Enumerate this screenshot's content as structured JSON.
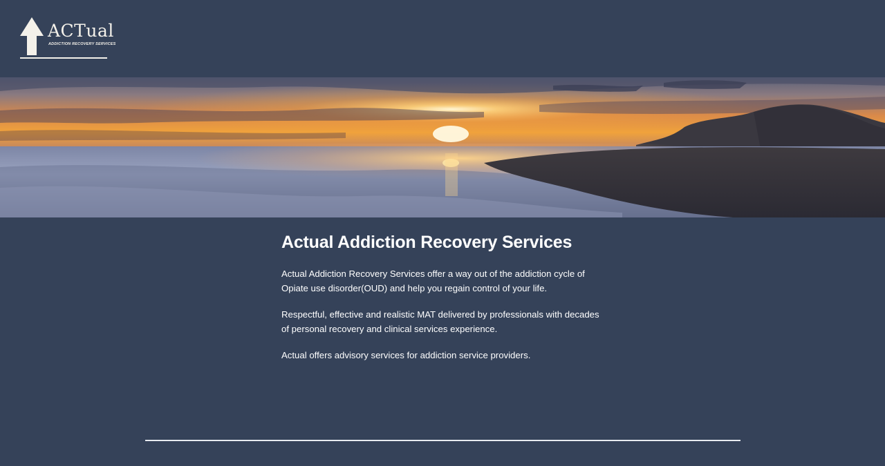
{
  "header": {
    "logo": {
      "title": "ACTual",
      "subtitle": "ADDICTION RECOVERY SERVICES",
      "icon": "up-arrow-icon"
    }
  },
  "hero": {
    "image": "sunset-beach-banner"
  },
  "main": {
    "heading": "Actual Addiction Recovery Services",
    "paragraphs": [
      "Actual Addiction Recovery Services offer a way out of the addiction cycle of Opiate use disorder(OUD) and help you regain control of your life.",
      "Respectful, effective and realistic MAT delivered by professionals with decades of personal recovery and clinical services experience.",
      "Actual offers advisory services for addiction service providers."
    ]
  },
  "colors": {
    "background": "#354259",
    "text": "#ffffff",
    "logo": "#f4f1ea"
  }
}
